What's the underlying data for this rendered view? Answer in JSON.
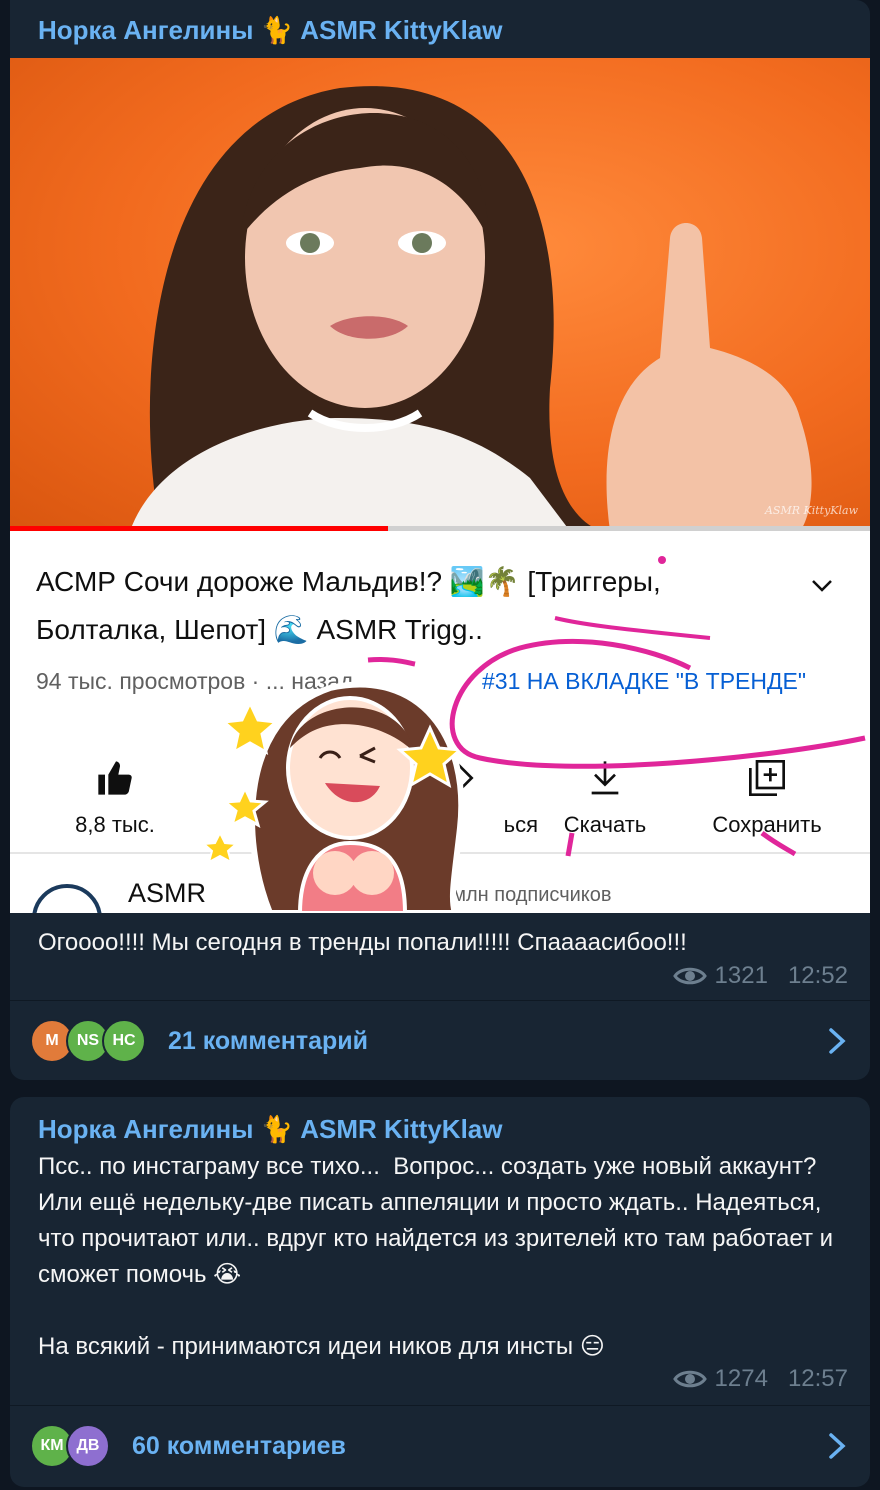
{
  "posts": [
    {
      "channel": "Норка Ангелины 🐈 ASMR KittyKlaw",
      "screenshot": {
        "watermark": "ASMR KittyKlaw",
        "title": "АСМР Сочи дороже Мальдив!? 🏞️🌴 [Триггеры, Болталка, Шепот] 🌊 ASMR Trigg..",
        "meta": "94 тыс. просмотров · ... назад",
        "trend": "#31 НА ВКЛАДКЕ \"В ТРЕНДЕ\"",
        "actions": [
          {
            "label": "8,8 тыс.",
            "icon": "thumbs-up-icon"
          },
          {
            "label": "ься",
            "icon": "share-icon"
          },
          {
            "label": "Скачать",
            "icon": "download-icon"
          },
          {
            "label": "Сохранить",
            "icon": "save-to-playlist-icon"
          }
        ],
        "channel_name": "ASMR",
        "subscribers": "... млн подписчиков",
        "progress_fraction": 0.44
      },
      "text": "Огоооо!!!! Мы сегодня в тренды попали!!!!! Спаааасибоо!!!",
      "views": "1321",
      "time": "12:52",
      "comments": {
        "label": "21 комментарий",
        "avatars": [
          {
            "initials": "M",
            "color": "#e17b3a"
          },
          {
            "initials": "NS",
            "color": "#5fb24a"
          },
          {
            "initials": "НС",
            "color": "#5fb24a"
          }
        ]
      }
    },
    {
      "channel": "Норка Ангелины 🐈 ASMR KittyKlaw",
      "text": "Псс.. по инстаграму все тихо...  Вопрос... создать уже новый аккаунт? Или ещё недельку-две писать аппеляции и просто ждать.. Надеяться, что прочитают или.. вдруг кто найдется из зрителей кто там работает и сможет помочь 😭\n\nНа всякий - принимаются идеи ников для инсты 😑",
      "views": "1274",
      "time": "12:57",
      "comments": {
        "label": "60 комментариев",
        "avatars": [
          {
            "initials": "КМ",
            "color": "#5fb24a"
          },
          {
            "initials": "ДВ",
            "color": "#8e6fd0"
          }
        ]
      }
    }
  ],
  "colors": {
    "background": "#0e1621",
    "bubble": "#182533",
    "accent": "#6ab2f2",
    "meta": "#6d7f8f",
    "annotation_pink": "#e0269a"
  }
}
